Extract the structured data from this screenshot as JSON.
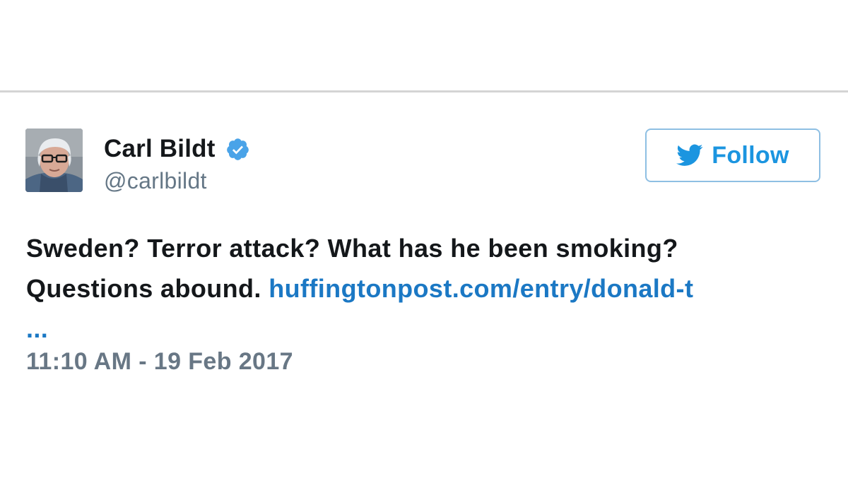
{
  "tweet": {
    "author": {
      "display_name": "Carl Bildt",
      "handle": "@carlbildt",
      "verified": true,
      "avatar_icon": "profile-photo"
    },
    "follow_button": {
      "label": "Follow",
      "icon": "twitter-bird-icon"
    },
    "text_line1": "Sweden? Terror attack? What has he been smoking?",
    "text_line2": "Questions abound. ",
    "link_text": "huffingtonpost.com/entry/donald-t",
    "link_ellipsis": "...",
    "timestamp": "11:10 AM - 19 Feb 2017"
  },
  "colors": {
    "link": "#1b78c4",
    "follow_accent": "#1b95e0",
    "verified_badge": "#4aa3e8",
    "muted_text": "#657786"
  }
}
